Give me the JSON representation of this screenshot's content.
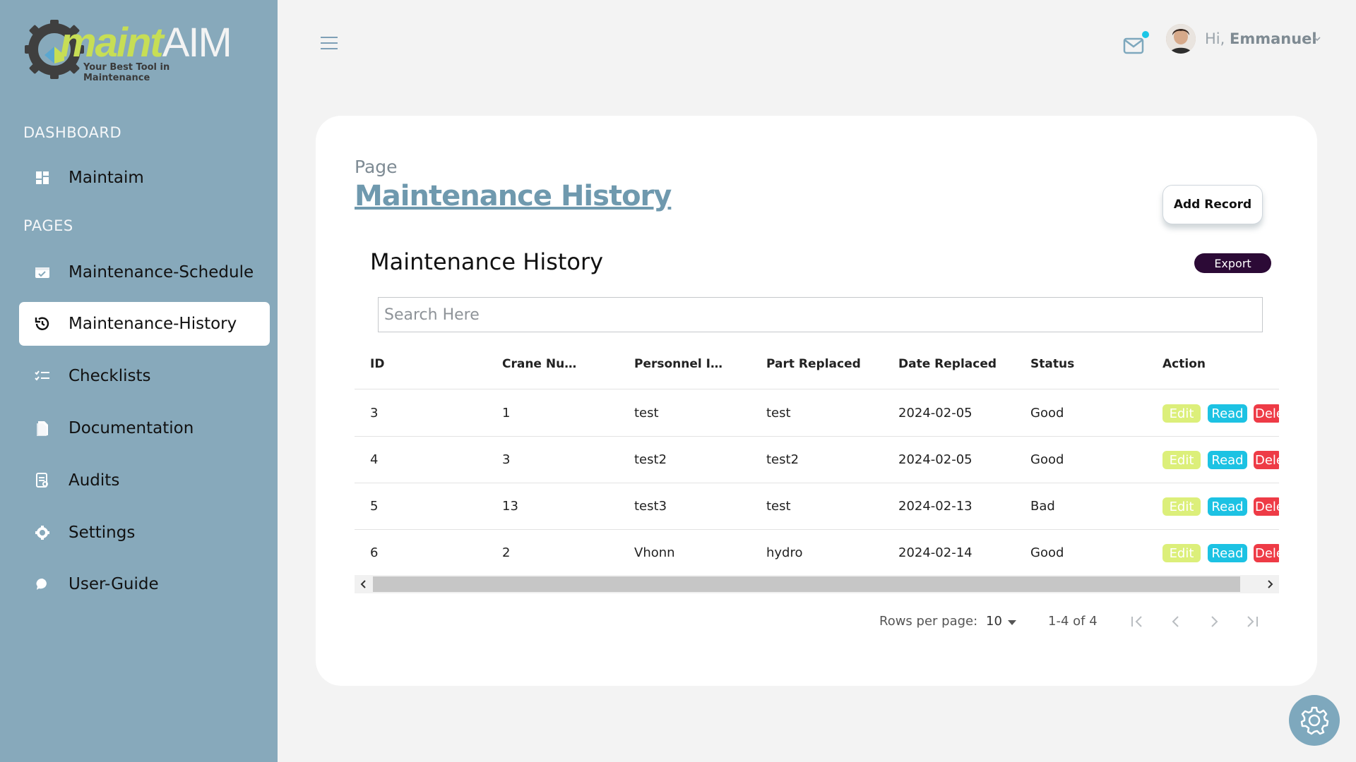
{
  "brand": {
    "logo_part1": "maint",
    "logo_part2": "AIM",
    "tagline": "Your Best Tool in Maintenance"
  },
  "sidebar": {
    "section_dashboard": "DASHBOARD",
    "section_pages": "PAGES",
    "items": [
      {
        "label": "Maintaim",
        "icon": "dashboard-icon"
      },
      {
        "label": "Maintenance-Schedule",
        "icon": "calendar-check-icon"
      },
      {
        "label": "Maintenance-History",
        "icon": "history-icon",
        "active": true
      },
      {
        "label": "Checklists",
        "icon": "checklist-icon"
      },
      {
        "label": "Documentation",
        "icon": "document-icon"
      },
      {
        "label": "Audits",
        "icon": "audit-icon"
      },
      {
        "label": "Settings",
        "icon": "gear-icon"
      },
      {
        "label": "User-Guide",
        "icon": "chat-bubble-icon"
      }
    ]
  },
  "header": {
    "greeting_prefix": "Hi,",
    "user_name": "Emmanuel"
  },
  "page": {
    "kicker": "Page",
    "title": "Maintenance History",
    "add_button": "Add Record"
  },
  "table": {
    "title": "Maintenance History",
    "export_label": "Export",
    "search_placeholder": "Search Here",
    "columns": [
      "ID",
      "Crane Numb...",
      "Personnel Inc...",
      "Part Replaced",
      "Date Replaced",
      "Status",
      "Action"
    ],
    "rows": [
      {
        "id": "3",
        "crane": "1",
        "personnel": "test",
        "part": "test",
        "date": "2024-02-05",
        "status": "Good"
      },
      {
        "id": "4",
        "crane": "3",
        "personnel": "test2",
        "part": "test2",
        "date": "2024-02-05",
        "status": "Good"
      },
      {
        "id": "5",
        "crane": "13",
        "personnel": "test3",
        "part": "test",
        "date": "2024-02-13",
        "status": "Bad"
      },
      {
        "id": "6",
        "crane": "2",
        "personnel": "Vhonn",
        "part": "hydro",
        "date": "2024-02-14",
        "status": "Good"
      }
    ],
    "actions": {
      "edit": "Edit",
      "read": "Read",
      "delete": "Dele"
    }
  },
  "pagination": {
    "rows_per_page_label": "Rows per page:",
    "rows_per_page_value": "10",
    "range": "1-4 of 4"
  },
  "colors": {
    "sidebar_bg": "#87a9bb",
    "title_color": "#6f99ae",
    "export_bg": "#2c0a36",
    "edit_bg": "#dcef7a",
    "read_bg": "#1cc2e3",
    "delete_bg": "#ee3b46",
    "notification_dot": "#1cc6e6"
  }
}
